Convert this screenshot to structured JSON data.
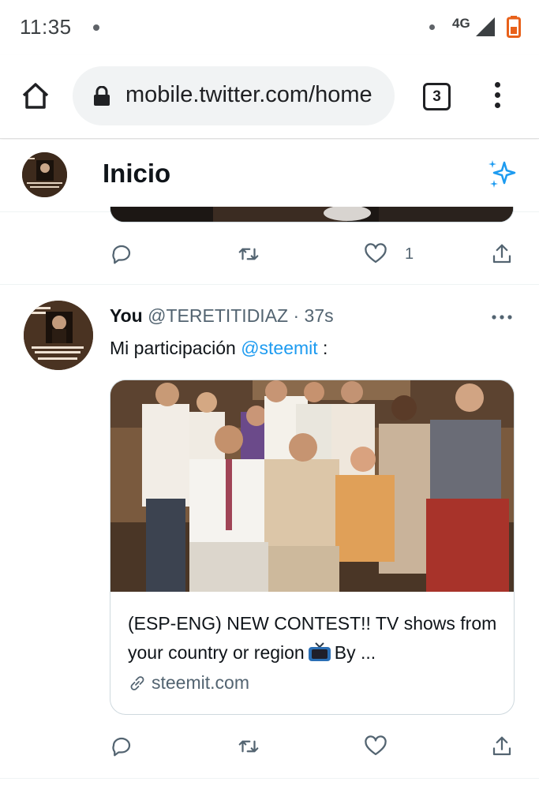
{
  "status_bar": {
    "time": "11:35",
    "network": "4G",
    "battery_color": "#e8611a"
  },
  "browser": {
    "url": "mobile.twitter.com/home",
    "tab_count": "3"
  },
  "header": {
    "title": "Inicio",
    "accent_color": "#1d9bf0"
  },
  "prev_tweet": {
    "like_count": "1"
  },
  "tweet": {
    "name": "You",
    "handle": "@TERETITIDIAZ",
    "separator": "·",
    "time": "37s",
    "text_prefix": "Mi participación ",
    "mention": "@steemit",
    "text_suffix": " :",
    "card": {
      "title_part1": "(ESP-ENG) NEW CONTEST!! TV shows from your country or region",
      "title_part2": "By ...",
      "domain": "steemit.com"
    }
  },
  "icons": [
    "home-icon",
    "lock-icon",
    "tabs-icon",
    "menu-icon",
    "sparkle-icon",
    "reply-icon",
    "retweet-icon",
    "like-icon",
    "share-icon",
    "more-icon",
    "link-icon",
    "tv-icon",
    "signal-icon",
    "battery-icon"
  ]
}
